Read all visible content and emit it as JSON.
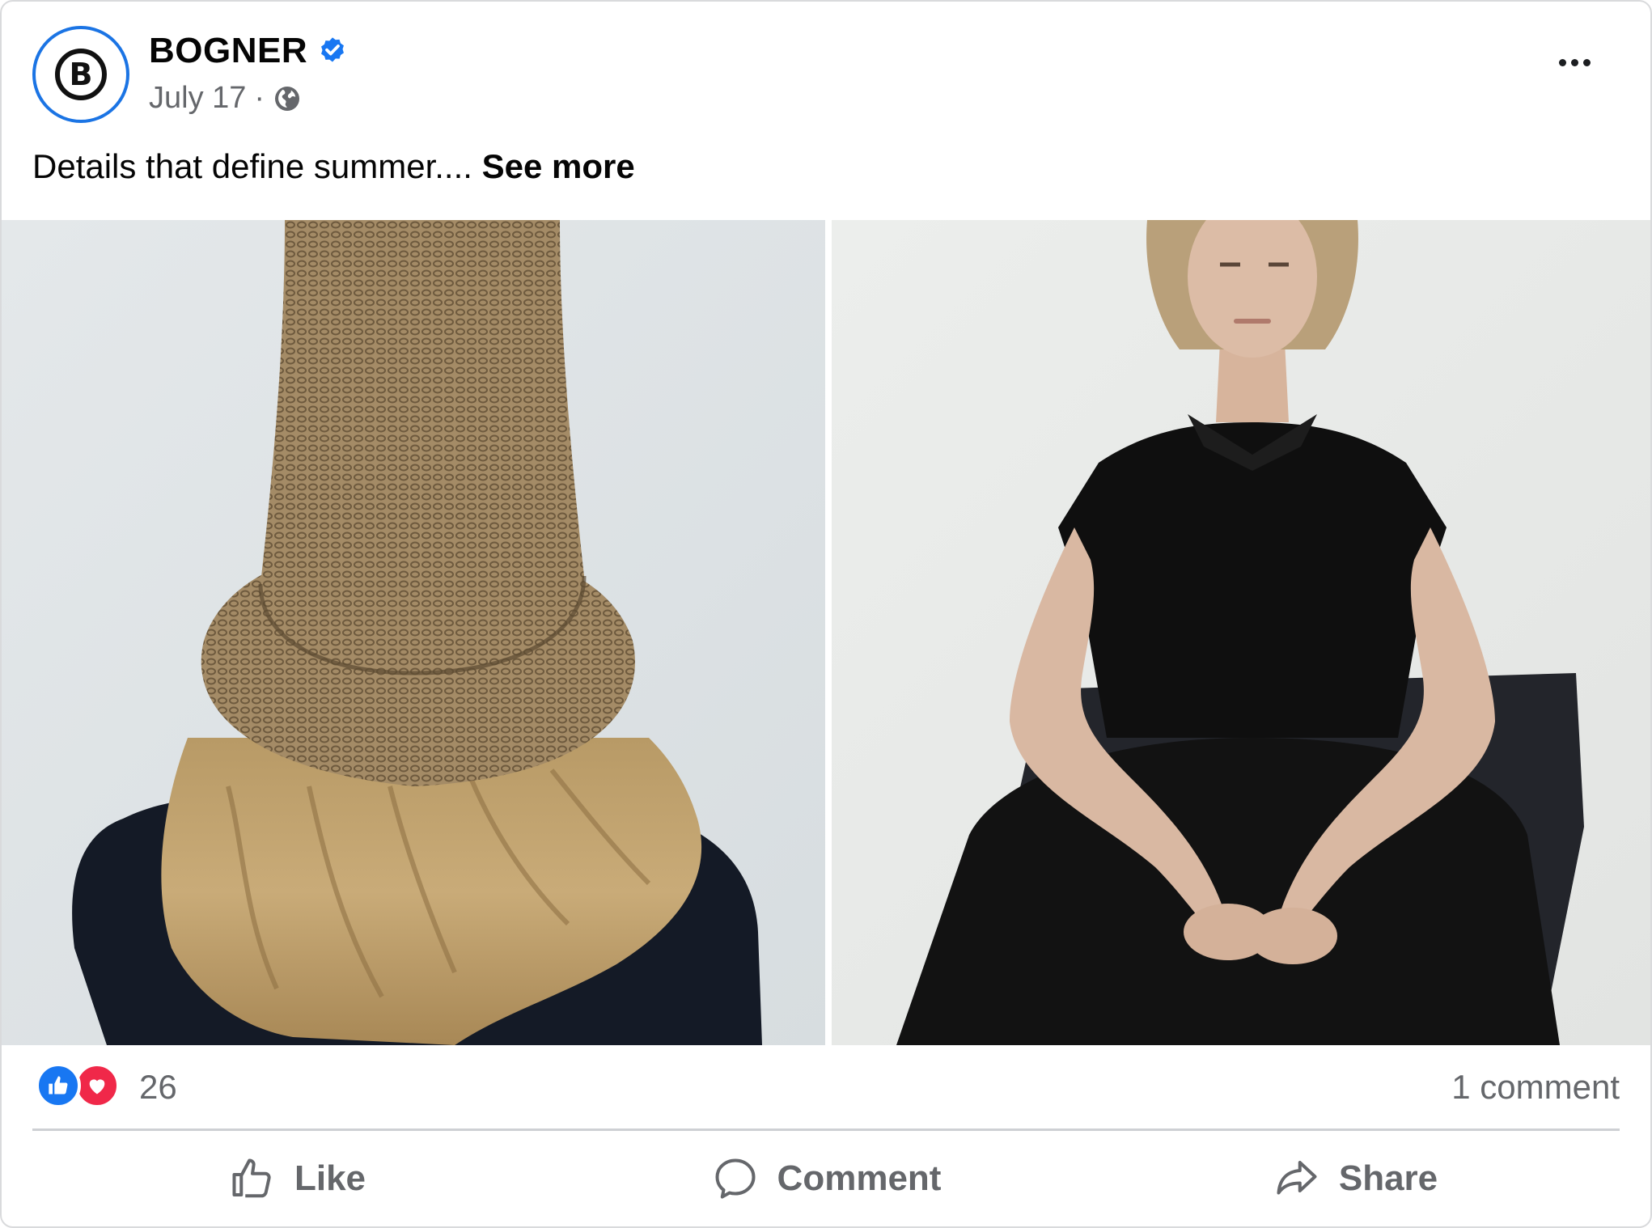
{
  "post": {
    "author": {
      "name": "BOGNER",
      "avatar_letter": "B",
      "verified_icon": "verified-badge-icon"
    },
    "date": "July 17",
    "date_separator": "·",
    "audience_icon": "globe-icon",
    "text": "Details that define summer....",
    "see_more_label": "See more"
  },
  "reactions": {
    "count": "26",
    "types": [
      "like",
      "love"
    ],
    "comments_label": "1 comment"
  },
  "actions": {
    "like_label": "Like",
    "comment_label": "Comment",
    "share_label": "Share"
  },
  "colors": {
    "accent": "#1b74e4",
    "like": "#1877f2",
    "love": "#f02849",
    "muted_text": "#65676b"
  }
}
